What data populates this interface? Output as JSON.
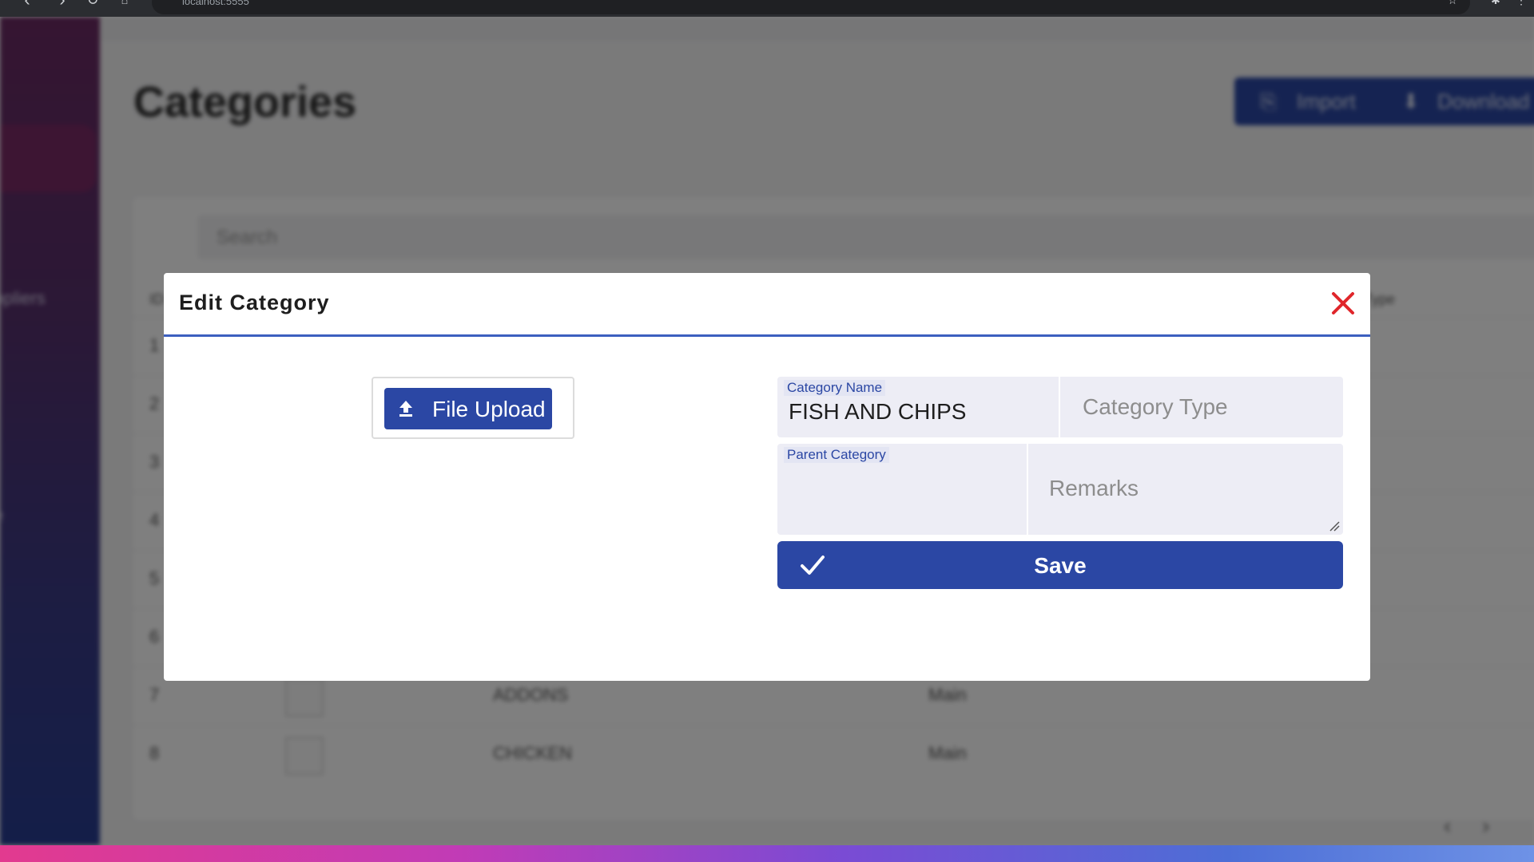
{
  "browser": {
    "url": "localhost:5555"
  },
  "app": {
    "page_title": "Categories",
    "header_buttons": [
      "Import",
      "Download"
    ],
    "search_placeholder": "Search",
    "sidebar_labels": [
      "ppliers",
      "e"
    ],
    "table_header": {
      "id": "ID",
      "type": "Type"
    },
    "rows": [
      {
        "id": "1",
        "name": "",
        "type": ""
      },
      {
        "id": "2",
        "name": "",
        "type": ""
      },
      {
        "id": "3",
        "name": "",
        "type": ""
      },
      {
        "id": "4",
        "name": "",
        "type": ""
      },
      {
        "id": "5",
        "name": "",
        "type": ""
      },
      {
        "id": "6",
        "name": "",
        "type": ""
      },
      {
        "id": "7",
        "name": "ADDONS",
        "type": "Main"
      },
      {
        "id": "8",
        "name": "CHICKEN",
        "type": "Main"
      }
    ],
    "pager": {
      "prev": "‹",
      "next": "›"
    }
  },
  "dialog": {
    "title": "Edit Category",
    "upload_label": "File Upload",
    "category_name_label": "Category Name",
    "category_name_value": "FISH AND CHIPS",
    "category_type_placeholder": "Category Type",
    "parent_category_label": "Parent Category",
    "parent_category_value": "",
    "remarks_placeholder": "Remarks",
    "save_label": "Save"
  },
  "colors": {
    "accent": "#2b47a4",
    "close": "#e0262b"
  }
}
